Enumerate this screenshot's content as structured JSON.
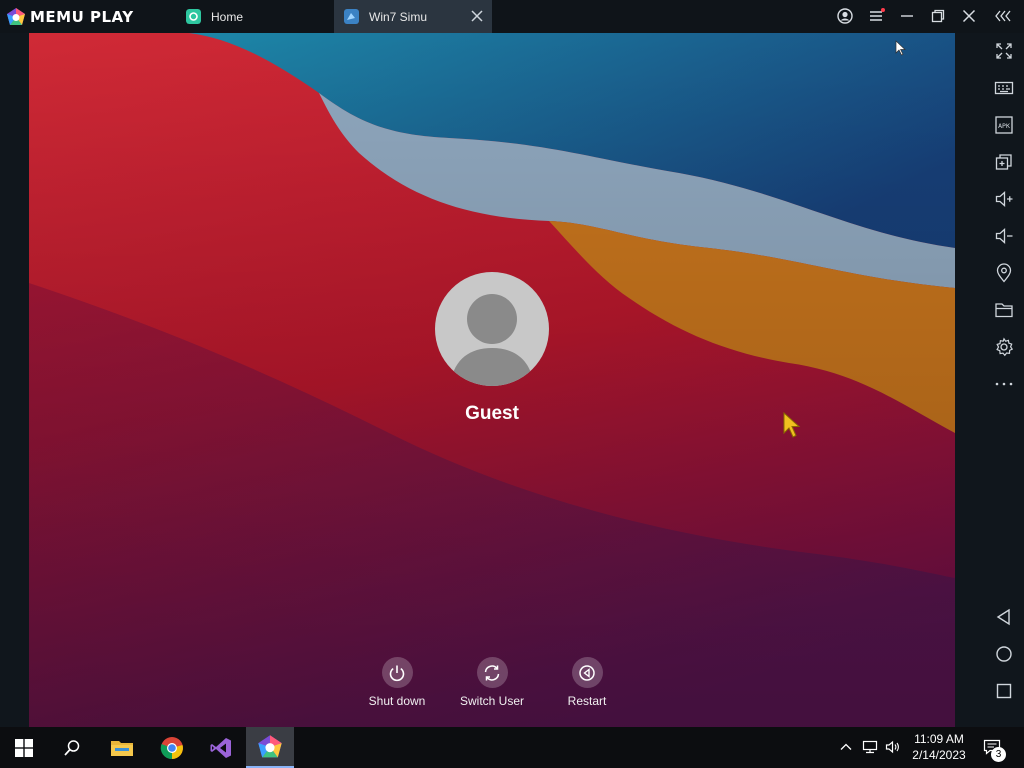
{
  "app": {
    "logo_text": "MEMU PLAY"
  },
  "tabs": [
    {
      "label": "Home",
      "active": false
    },
    {
      "label": "Win7 Simu",
      "active": true
    }
  ],
  "lock_screen": {
    "username": "Guest",
    "actions": [
      {
        "label": "Shut down",
        "icon": "power-icon"
      },
      {
        "label": "Switch User",
        "icon": "switch-user-icon"
      },
      {
        "label": "Restart",
        "icon": "restart-icon"
      }
    ]
  },
  "sidebar": {
    "items": [
      "fullscreen-icon",
      "keyboard-icon",
      "apk-icon",
      "multi-instance-icon",
      "volume-up-icon",
      "volume-down-icon",
      "location-icon",
      "folder-icon",
      "settings-icon",
      "more-icon"
    ],
    "nav": [
      "back-icon",
      "home-icon",
      "recents-icon"
    ],
    "apk_label": "APK"
  },
  "taskbar": {
    "time": "11:09 AM",
    "date": "2/14/2023",
    "notification_count": "3"
  },
  "colors": {
    "titlebar": "#0f1419",
    "active_tab": "#2b3540",
    "wallpaper_red": "#b81c2c",
    "wallpaper_blue": "#1f6a93",
    "wallpaper_orange": "#d4781c"
  }
}
